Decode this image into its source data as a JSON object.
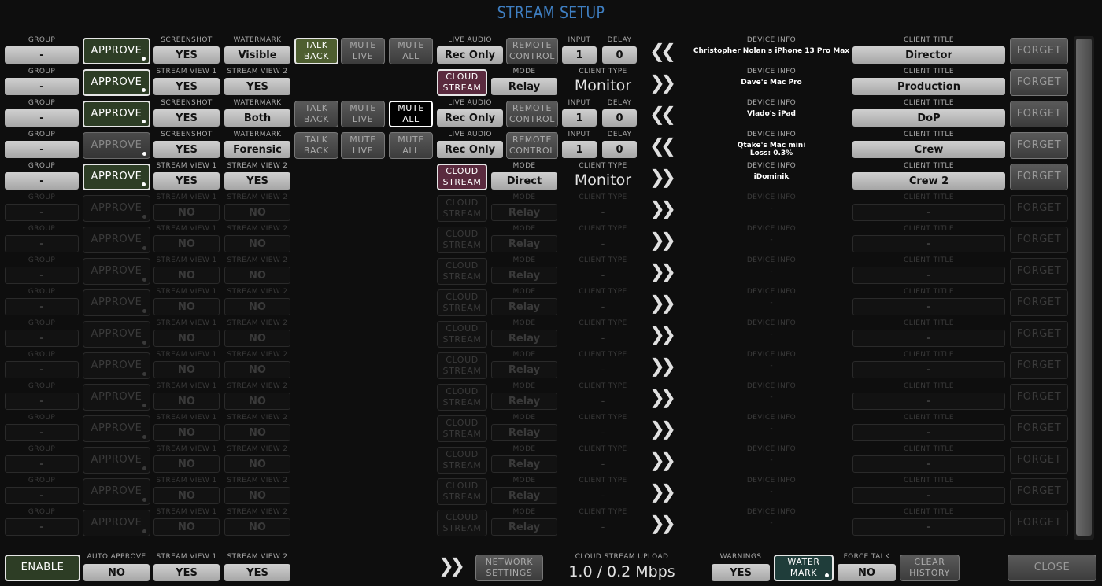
{
  "title": "STREAM SETUP",
  "labels": {
    "group": "GROUP",
    "screenshot": "SCREENSHOT",
    "watermark": "WATERMARK",
    "stream_view_1": "STREAM VIEW 1",
    "stream_view_2": "STREAM VIEW 2",
    "live_audio": "LIVE AUDIO",
    "mode": "MODE",
    "client_type": "CLIENT TYPE",
    "input": "INPUT",
    "delay": "DELAY",
    "device_info": "DEVICE INFO",
    "client_title": "CLIENT TITLE"
  },
  "buttons": {
    "approve": "APPROVE",
    "talk": "TALK",
    "back": "BACK",
    "mute": "MUTE",
    "live": "LIVE",
    "all": "ALL",
    "remote": "REMOTE",
    "control": "CONTROL",
    "cloud": "CLOUD",
    "stream": "STREAM",
    "forget": "FORGET"
  },
  "arrows": {
    "left": "❮❮",
    "right": "❯❯"
  },
  "rows": [
    {
      "kind": "recorder",
      "approved": true,
      "group": "-",
      "screenshot": "YES",
      "watermark": "Visible",
      "talkback": true,
      "mute_live": false,
      "mute_all": false,
      "live_audio": "Rec Only",
      "input": "1",
      "delay": "0",
      "direction": "left",
      "device_info": [
        "Christopher Nolan's iPhone 13 Pro Max"
      ],
      "client_title": "Director"
    },
    {
      "kind": "cloud",
      "approved": true,
      "group": "-",
      "stream_view_1": "YES",
      "stream_view_2": "YES",
      "mode": "Relay",
      "client_type": "Monitor",
      "direction": "right",
      "device_info": [
        "Dave's Mac Pro"
      ],
      "client_title": "Production"
    },
    {
      "kind": "recorder",
      "approved": true,
      "group": "-",
      "screenshot": "YES",
      "watermark": "Both",
      "talkback": false,
      "mute_live": false,
      "mute_all": true,
      "live_audio": "Rec Only",
      "input": "1",
      "delay": "0",
      "direction": "left",
      "device_info": [
        "Vlado's iPad"
      ],
      "client_title": "DoP"
    },
    {
      "kind": "recorder",
      "approved": false,
      "group": "-",
      "screenshot": "YES",
      "watermark": "Forensic",
      "talkback": false,
      "mute_live": false,
      "mute_all": false,
      "live_audio": "Rec Only",
      "input": "1",
      "delay": "0",
      "direction": "left",
      "device_info": [
        "Qtake's Mac mini",
        "Loss: 0.3%"
      ],
      "client_title": "Crew"
    },
    {
      "kind": "cloud",
      "approved": true,
      "group": "-",
      "stream_view_1": "YES",
      "stream_view_2": "YES",
      "mode": "Direct",
      "client_type": "Monitor",
      "direction": "right",
      "device_info": [
        "iDominik"
      ],
      "client_title": "Crew 2"
    }
  ],
  "empty_row": {
    "group": "-",
    "stream_view_1": "NO",
    "stream_view_2": "NO",
    "mode": "Relay",
    "client_type": "-",
    "device_info": "-",
    "client_title": "-"
  },
  "empty_row_count": 11,
  "footer": {
    "enable": "ENABLE",
    "auto_approve_label": "AUTO APPROVE",
    "auto_approve": "NO",
    "stream_view_1_label": "STREAM VIEW 1",
    "stream_view_1": "YES",
    "stream_view_2_label": "STREAM VIEW 2",
    "stream_view_2": "YES",
    "network_line1": "NETWORK",
    "network_line2": "SETTINGS",
    "upload_label": "CLOUD STREAM UPLOAD",
    "upload_value": "1.0 / 0.2 Mbps",
    "warnings_label": "WARNINGS",
    "warnings": "YES",
    "water_line1": "WATER",
    "water_line2": "MARK",
    "force_talk_label": "FORCE TALK",
    "force_talk": "NO",
    "clear_line1": "CLEAR",
    "clear_line2": "HISTORY",
    "close": "CLOSE"
  },
  "colors": {
    "title": "#3f7fc2",
    "approve_green": "#2d3d25",
    "talk_green": "#4e5e30",
    "cloud_purple": "#5a2a3e",
    "watermark_teal": "#1f3d3a"
  }
}
